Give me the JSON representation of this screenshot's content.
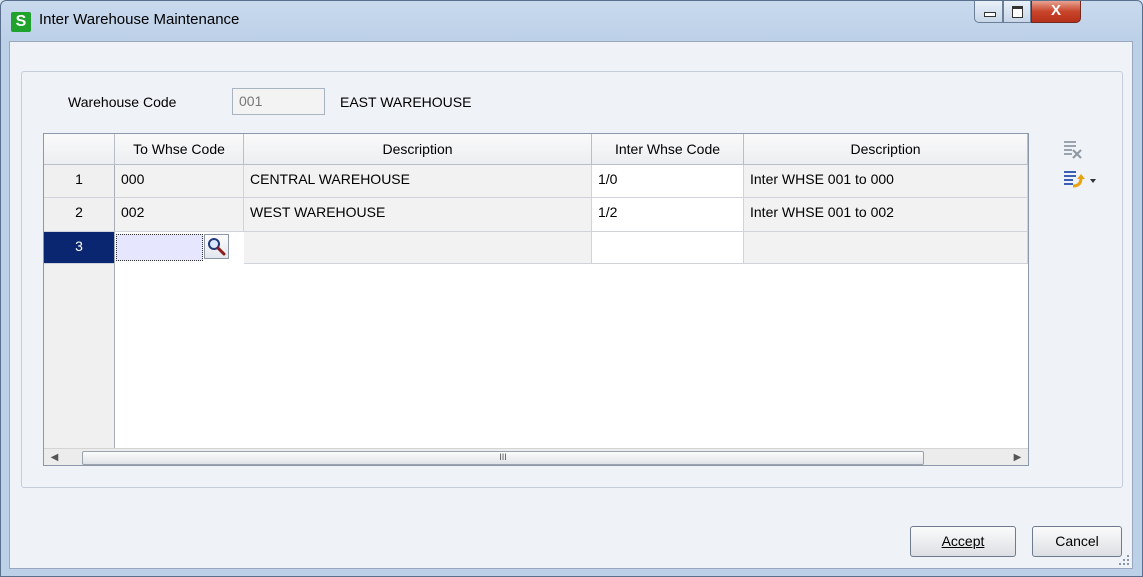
{
  "window": {
    "title": "Inter Warehouse Maintenance",
    "app_icon_letter": "S",
    "close_glyph": "X"
  },
  "form": {
    "warehouse_code_label": "Warehouse Code",
    "warehouse_code_value": "001",
    "warehouse_name": "EAST WAREHOUSE"
  },
  "grid": {
    "columns": [
      "To Whse Code",
      "Description",
      "Inter Whse Code",
      "Description"
    ],
    "rows": [
      {
        "num": "1",
        "to_whse_code": "000",
        "description": "CENTRAL WAREHOUSE",
        "inter_whse_code": "1/0",
        "inter_description": "Inter WHSE 001 to 000"
      },
      {
        "num": "2",
        "to_whse_code": "002",
        "description": "WEST WAREHOUSE",
        "inter_whse_code": "1/2",
        "inter_description": "Inter WHSE 001 to 002"
      },
      {
        "num": "3",
        "to_whse_code": "",
        "description": "",
        "inter_whse_code": "",
        "inter_description": ""
      }
    ],
    "scroll_thumb_glyph": "III"
  },
  "buttons": {
    "accept": "Accept",
    "cancel": "Cancel"
  },
  "colors": {
    "selected_row": "#0b2670",
    "active_cell": "#e6e6ff",
    "app_icon": "#1fa32c"
  },
  "icons": {
    "delete_row": "delete-row-icon",
    "insert_row": "insert-row-icon",
    "lookup": "magnifier-icon"
  }
}
